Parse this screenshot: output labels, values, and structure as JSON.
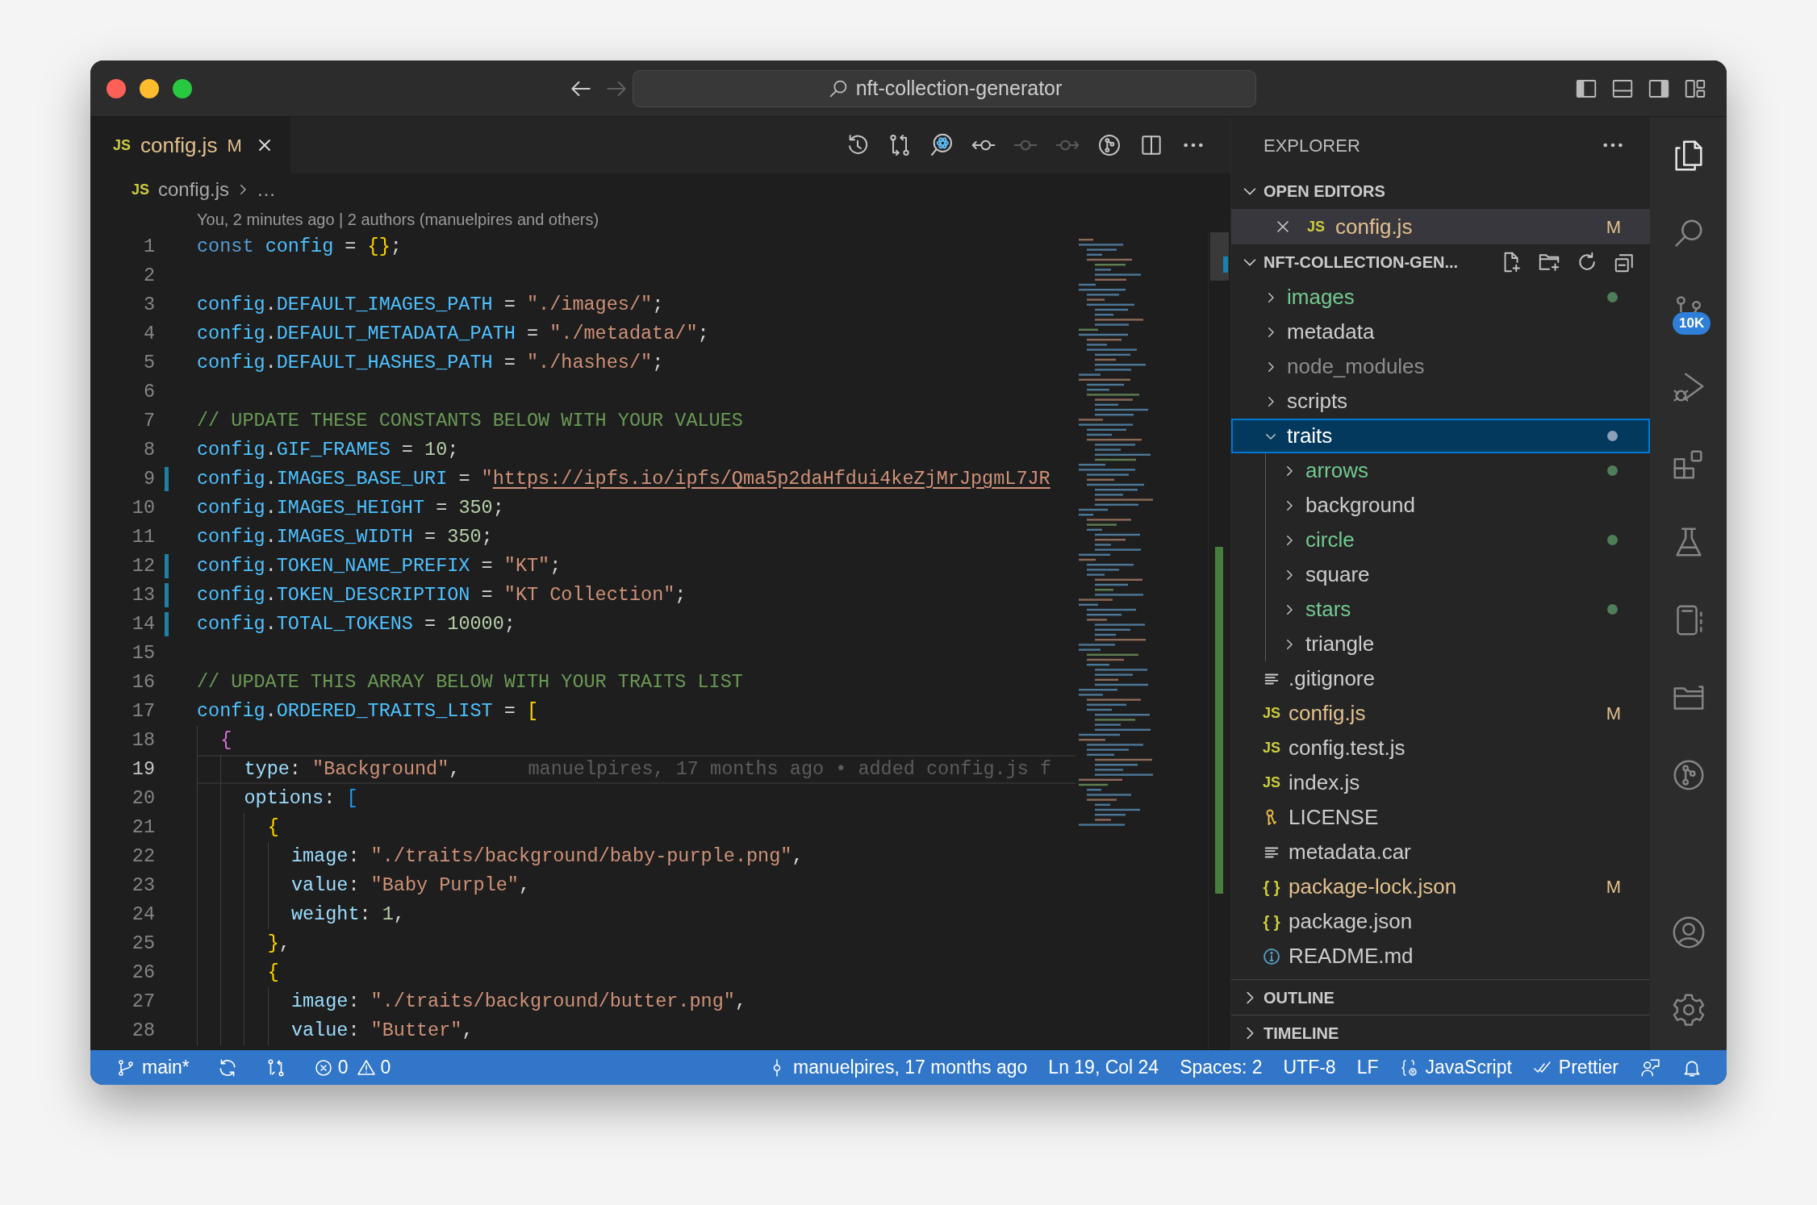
{
  "titlebar": {
    "title": "nft-collection-generator",
    "nav": [
      {
        "kind": "back",
        "disabled": false
      },
      {
        "kind": "forward",
        "disabled": true
      }
    ]
  },
  "tabs": [
    {
      "label": "config.js",
      "icon": {
        "kind": "js",
        "text": "JS"
      },
      "color": "#e2c08d",
      "badge": "M",
      "selected": true
    }
  ],
  "editor_actions": [
    {
      "kind": "history",
      "disabled": false
    },
    {
      "kind": "compare",
      "disabled": false
    },
    {
      "kind": "inspect",
      "disabled": false
    },
    {
      "kind": "previous",
      "disabled": false
    },
    {
      "kind": "current",
      "disabled": true
    },
    {
      "kind": "next",
      "disabled": true
    },
    {
      "kind": "graph",
      "disabled": false
    },
    {
      "kind": "split",
      "disabled": false
    },
    {
      "kind": "more",
      "disabled": false
    }
  ],
  "breadcrumb": [
    {
      "label": "config.js",
      "icon": {
        "kind": "js",
        "text": "JS"
      }
    },
    {
      "label": "…"
    }
  ],
  "codelens": "You, 2 minutes ago | 2 authors (manuelpires and others)",
  "editor": {
    "lines": [
      {
        "number": "1",
        "modified": false,
        "current": false,
        "tokens": [
          {
            "kind": "keyword",
            "text": "const "
          },
          {
            "kind": "variable",
            "text": "config"
          },
          {
            "kind": "punct",
            "text": " = "
          },
          {
            "kind": "bracket1",
            "text": "{}"
          },
          {
            "kind": "punct",
            "text": ";"
          }
        ]
      },
      {
        "number": "2",
        "modified": false,
        "current": false
      },
      {
        "number": "3",
        "modified": false,
        "current": false,
        "tokens": [
          {
            "kind": "variable",
            "text": "config"
          },
          {
            "kind": "punct",
            "text": "."
          },
          {
            "kind": "constant",
            "text": "DEFAULT_IMAGES_PATH"
          },
          {
            "kind": "punct",
            "text": " = "
          },
          {
            "kind": "string",
            "text": "\"./images/\""
          },
          {
            "kind": "punct",
            "text": ";"
          }
        ]
      },
      {
        "number": "4",
        "modified": false,
        "current": false,
        "tokens": [
          {
            "kind": "variable",
            "text": "config"
          },
          {
            "kind": "punct",
            "text": "."
          },
          {
            "kind": "constant",
            "text": "DEFAULT_METADATA_PATH"
          },
          {
            "kind": "punct",
            "text": " = "
          },
          {
            "kind": "string",
            "text": "\"./metadata/\""
          },
          {
            "kind": "punct",
            "text": ";"
          }
        ]
      },
      {
        "number": "5",
        "modified": false,
        "current": false,
        "tokens": [
          {
            "kind": "variable",
            "text": "config"
          },
          {
            "kind": "punct",
            "text": "."
          },
          {
            "kind": "constant",
            "text": "DEFAULT_HASHES_PATH"
          },
          {
            "kind": "punct",
            "text": " = "
          },
          {
            "kind": "string",
            "text": "\"./hashes/\""
          },
          {
            "kind": "punct",
            "text": ";"
          }
        ]
      },
      {
        "number": "6",
        "modified": false,
        "current": false
      },
      {
        "number": "7",
        "modified": false,
        "current": false,
        "tokens": [
          {
            "kind": "comment",
            "text": "// UPDATE THESE CONSTANTS BELOW WITH YOUR VALUES"
          }
        ]
      },
      {
        "number": "8",
        "modified": false,
        "current": false,
        "tokens": [
          {
            "kind": "variable",
            "text": "config"
          },
          {
            "kind": "punct",
            "text": "."
          },
          {
            "kind": "constant",
            "text": "GIF_FRAMES"
          },
          {
            "kind": "punct",
            "text": " = "
          },
          {
            "kind": "number",
            "text": "10"
          },
          {
            "kind": "punct",
            "text": ";"
          }
        ]
      },
      {
        "number": "9",
        "modified": true,
        "current": false,
        "tokens": [
          {
            "kind": "variable",
            "text": "config"
          },
          {
            "kind": "punct",
            "text": "."
          },
          {
            "kind": "constant",
            "text": "IMAGES_BASE_URI"
          },
          {
            "kind": "punct",
            "text": " = "
          },
          {
            "kind": "string",
            "text": "\""
          },
          {
            "kind": "link",
            "text": "https://ipfs.io/ipfs/Qma5p2daHfdui4keZjMrJpgmL7JR"
          }
        ]
      },
      {
        "number": "10",
        "modified": false,
        "current": false,
        "tokens": [
          {
            "kind": "variable",
            "text": "config"
          },
          {
            "kind": "punct",
            "text": "."
          },
          {
            "kind": "constant",
            "text": "IMAGES_HEIGHT"
          },
          {
            "kind": "punct",
            "text": " = "
          },
          {
            "kind": "number",
            "text": "350"
          },
          {
            "kind": "punct",
            "text": ";"
          }
        ]
      },
      {
        "number": "11",
        "modified": false,
        "current": false,
        "tokens": [
          {
            "kind": "variable",
            "text": "config"
          },
          {
            "kind": "punct",
            "text": "."
          },
          {
            "kind": "constant",
            "text": "IMAGES_WIDTH"
          },
          {
            "kind": "punct",
            "text": " = "
          },
          {
            "kind": "number",
            "text": "350"
          },
          {
            "kind": "punct",
            "text": ";"
          }
        ]
      },
      {
        "number": "12",
        "modified": true,
        "current": false,
        "tokens": [
          {
            "kind": "variable",
            "text": "config"
          },
          {
            "kind": "punct",
            "text": "."
          },
          {
            "kind": "constant",
            "text": "TOKEN_NAME_PREFIX"
          },
          {
            "kind": "punct",
            "text": " = "
          },
          {
            "kind": "string",
            "text": "\"KT\""
          },
          {
            "kind": "punct",
            "text": ";"
          }
        ]
      },
      {
        "number": "13",
        "modified": true,
        "current": false,
        "tokens": [
          {
            "kind": "variable",
            "text": "config"
          },
          {
            "kind": "punct",
            "text": "."
          },
          {
            "kind": "constant",
            "text": "TOKEN_DESCRIPTION"
          },
          {
            "kind": "punct",
            "text": " = "
          },
          {
            "kind": "string",
            "text": "\"KT Collection\""
          },
          {
            "kind": "punct",
            "text": ";"
          }
        ]
      },
      {
        "number": "14",
        "modified": true,
        "current": false,
        "tokens": [
          {
            "kind": "variable",
            "text": "config"
          },
          {
            "kind": "punct",
            "text": "."
          },
          {
            "kind": "constant",
            "text": "TOTAL_TOKENS"
          },
          {
            "kind": "punct",
            "text": " = "
          },
          {
            "kind": "number",
            "text": "10000"
          },
          {
            "kind": "punct",
            "text": ";"
          }
        ]
      },
      {
        "number": "15",
        "modified": false,
        "current": false
      },
      {
        "number": "16",
        "modified": false,
        "current": false,
        "tokens": [
          {
            "kind": "comment",
            "text": "// UPDATE THIS ARRAY BELOW WITH YOUR TRAITS LIST"
          }
        ]
      },
      {
        "number": "17",
        "modified": false,
        "current": false,
        "tokens": [
          {
            "kind": "variable",
            "text": "config"
          },
          {
            "kind": "punct",
            "text": "."
          },
          {
            "kind": "constant",
            "text": "ORDERED_TRAITS_LIST"
          },
          {
            "kind": "punct",
            "text": " = "
          },
          {
            "kind": "bracket1",
            "text": "["
          }
        ]
      },
      {
        "number": "18",
        "modified": false,
        "current": false,
        "tokens": [
          {
            "kind": "bracket2",
            "text": "  {"
          }
        ]
      },
      {
        "number": "19",
        "modified": false,
        "current": true,
        "blame": "manuelpires, 17 months ago • added config.js f",
        "tokens": [
          {
            "kind": "property",
            "text": "    type"
          },
          {
            "kind": "punct",
            "text": ": "
          },
          {
            "kind": "string",
            "text": "\"Background\""
          },
          {
            "kind": "punct",
            "text": ","
          }
        ]
      },
      {
        "number": "20",
        "modified": false,
        "current": false,
        "tokens": [
          {
            "kind": "property",
            "text": "    options"
          },
          {
            "kind": "punct",
            "text": ": "
          },
          {
            "kind": "bracket3",
            "text": "["
          }
        ]
      },
      {
        "number": "21",
        "modified": false,
        "current": false,
        "tokens": [
          {
            "kind": "bracket1",
            "text": "      {"
          }
        ]
      },
      {
        "number": "22",
        "modified": false,
        "current": false,
        "tokens": [
          {
            "kind": "property",
            "text": "        image"
          },
          {
            "kind": "punct",
            "text": ": "
          },
          {
            "kind": "string",
            "text": "\"./traits/background/baby-purple.png\""
          },
          {
            "kind": "punct",
            "text": ","
          }
        ]
      },
      {
        "number": "23",
        "modified": false,
        "current": false,
        "tokens": [
          {
            "kind": "property",
            "text": "        value"
          },
          {
            "kind": "punct",
            "text": ": "
          },
          {
            "kind": "string",
            "text": "\"Baby Purple\""
          },
          {
            "kind": "punct",
            "text": ","
          }
        ]
      },
      {
        "number": "24",
        "modified": false,
        "current": false,
        "tokens": [
          {
            "kind": "property",
            "text": "        weight"
          },
          {
            "kind": "punct",
            "text": ": "
          },
          {
            "kind": "number",
            "text": "1"
          },
          {
            "kind": "punct",
            "text": ","
          }
        ]
      },
      {
        "number": "25",
        "modified": false,
        "current": false,
        "tokens": [
          {
            "kind": "bracket1",
            "text": "      }"
          },
          {
            "kind": "punct",
            "text": ","
          }
        ]
      },
      {
        "number": "26",
        "modified": false,
        "current": false,
        "tokens": [
          {
            "kind": "bracket1",
            "text": "      {"
          }
        ]
      },
      {
        "number": "27",
        "modified": false,
        "current": false,
        "tokens": [
          {
            "kind": "property",
            "text": "        image"
          },
          {
            "kind": "punct",
            "text": ": "
          },
          {
            "kind": "string",
            "text": "\"./traits/background/butter.png\""
          },
          {
            "kind": "punct",
            "text": ","
          }
        ]
      },
      {
        "number": "28",
        "modified": false,
        "current": false,
        "tokens": [
          {
            "kind": "property",
            "text": "        value"
          },
          {
            "kind": "punct",
            "text": ": "
          },
          {
            "kind": "string",
            "text": "\"Butter\""
          },
          {
            "kind": "punct",
            "text": ","
          }
        ]
      }
    ]
  },
  "sidebar": {
    "title": "EXPLORER",
    "open_editors": {
      "title": "OPEN EDITORS",
      "expanded": true,
      "items": [
        {
          "name": "config.js",
          "icon": {
            "kind": "js",
            "text": "JS"
          },
          "color": "#e2c08d",
          "badge": "M",
          "selected": true
        }
      ]
    },
    "project": {
      "title": "NFT-COLLECTION-GEN...",
      "expanded": true,
      "tree": [
        {
          "name": "images",
          "kind": "folder",
          "expanded": false,
          "color": "#73c991",
          "dot": true,
          "selected": false
        },
        {
          "name": "metadata",
          "kind": "folder",
          "expanded": false,
          "color": "#cccccc",
          "dot": false,
          "selected": false
        },
        {
          "name": "node_modules",
          "kind": "folder",
          "expanded": false,
          "color": "#8c8c8c",
          "dot": false,
          "selected": false
        },
        {
          "name": "scripts",
          "kind": "folder",
          "expanded": false,
          "color": "#cccccc",
          "dot": false,
          "selected": false
        },
        {
          "name": "traits",
          "kind": "folder",
          "expanded": true,
          "dot": true,
          "selected": true,
          "children": [
            {
              "name": "arrows",
              "kind": "folder",
              "expanded": false,
              "color": "#73c991",
              "dot": true,
              "selected": false
            },
            {
              "name": "background",
              "kind": "folder",
              "expanded": false,
              "color": "#cccccc",
              "dot": false,
              "selected": false
            },
            {
              "name": "circle",
              "kind": "folder",
              "expanded": false,
              "color": "#73c991",
              "dot": true,
              "selected": false
            },
            {
              "name": "square",
              "kind": "folder",
              "expanded": false,
              "color": "#cccccc",
              "dot": false,
              "selected": false
            },
            {
              "name": "stars",
              "kind": "folder",
              "expanded": false,
              "color": "#73c991",
              "dot": true,
              "selected": false
            },
            {
              "name": "triangle",
              "kind": "folder",
              "expanded": false,
              "color": "#cccccc",
              "dot": false,
              "selected": false
            }
          ]
        },
        {
          "name": ".gitignore",
          "kind": "file",
          "icon": {
            "kind": "lines"
          },
          "color": "#cccccc",
          "selected": false
        },
        {
          "name": "config.js",
          "kind": "file",
          "icon": {
            "kind": "js",
            "text": "JS"
          },
          "color": "#e2c08d",
          "badge": "M",
          "selected": false
        },
        {
          "name": "config.test.js",
          "kind": "file",
          "icon": {
            "kind": "js",
            "text": "JS"
          },
          "color": "#cccccc",
          "selected": false
        },
        {
          "name": "index.js",
          "kind": "file",
          "icon": {
            "kind": "js",
            "text": "JS"
          },
          "color": "#cccccc",
          "selected": false
        },
        {
          "name": "LICENSE",
          "kind": "file",
          "icon": {
            "kind": "key"
          },
          "color": "#cccccc",
          "selected": false
        },
        {
          "name": "metadata.car",
          "kind": "file",
          "icon": {
            "kind": "lines"
          },
          "color": "#cccccc",
          "selected": false
        },
        {
          "name": "package-lock.json",
          "kind": "file",
          "icon": {
            "kind": "json",
            "text": "{ }"
          },
          "color": "#e2c08d",
          "badge": "M",
          "selected": false
        },
        {
          "name": "package.json",
          "kind": "file",
          "icon": {
            "kind": "json",
            "text": "{ }"
          },
          "color": "#cccccc",
          "selected": false
        },
        {
          "name": "README.md",
          "kind": "file",
          "icon": {
            "kind": "info"
          },
          "color": "#cccccc",
          "selected": false
        }
      ]
    },
    "collapsed_sections": [
      {
        "title": "OUTLINE",
        "expanded": false
      },
      {
        "title": "TIMELINE",
        "expanded": false
      }
    ]
  },
  "activity_bar": {
    "top": [
      {
        "kind": "explorer",
        "selected": true
      },
      {
        "kind": "search",
        "selected": false
      },
      {
        "kind": "source_control",
        "selected": false,
        "badge": "10K"
      },
      {
        "kind": "run_debug",
        "selected": false
      },
      {
        "kind": "extensions",
        "selected": false
      },
      {
        "kind": "testing",
        "selected": false
      },
      {
        "kind": "notebook",
        "selected": false
      },
      {
        "kind": "folder",
        "selected": false
      },
      {
        "kind": "graph",
        "selected": false
      }
    ],
    "bottom": [
      {
        "kind": "accounts",
        "selected": false
      },
      {
        "kind": "settings",
        "selected": false
      }
    ]
  },
  "status_bar": {
    "left": [
      {
        "kind": "branch",
        "text": "main*"
      },
      {
        "kind": "sync"
      },
      {
        "kind": "compare"
      },
      {
        "kind": "problems",
        "errors": "0",
        "warnings": "0"
      }
    ],
    "right": [
      {
        "kind": "blame",
        "text": "manuelpires, 17 months ago"
      },
      {
        "kind": "text",
        "text": "Ln 19, Col 24"
      },
      {
        "kind": "text",
        "text": "Spaces: 2"
      },
      {
        "kind": "text",
        "text": "UTF-8"
      },
      {
        "kind": "text",
        "text": "LF"
      },
      {
        "kind": "language",
        "text": "JavaScript"
      },
      {
        "kind": "formatter",
        "text": "Prettier"
      },
      {
        "kind": "feedback"
      },
      {
        "kind": "bell"
      }
    ]
  }
}
